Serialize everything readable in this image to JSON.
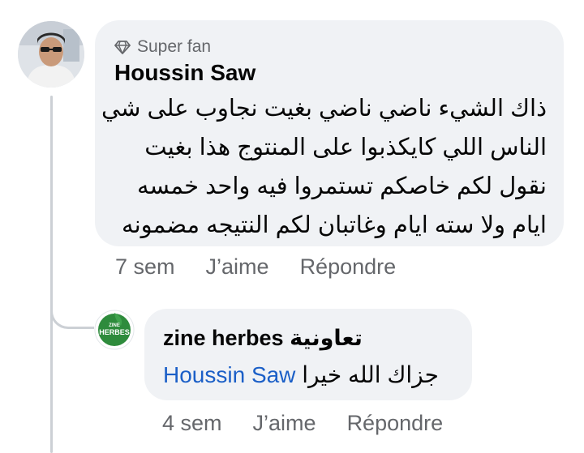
{
  "comment": {
    "badge": "Super fan",
    "author": "Houssin Saw",
    "lines": [
      "ذاك الشيء ناضي ناضي بغيت نجاوب على شي",
      "الناس اللي كايكذبوا على المنتوج هذا بغيت",
      "نقول لكم خاصكم تستمروا فيه واحد خمسه",
      "ايام ولا سته ايام وغاتبان لكم النتيجه مضمونه"
    ],
    "time": "7 sem",
    "like_label": "J’aime",
    "reply_label": "Répondre"
  },
  "reply": {
    "author": "zine herbes تعاونية",
    "mention": "Houssin Saw",
    "text": "جزاك الله خيرا",
    "logo_small": "ZINE",
    "logo_main": "HERBES",
    "time": "4 sem",
    "like_label": "J’aime",
    "reply_label": "Répondre"
  },
  "colors": {
    "bubble": "#f0f2f5",
    "meta_text": "#65676b",
    "mention": "#1b5fc7",
    "logo_green": "#2e8b3c"
  }
}
